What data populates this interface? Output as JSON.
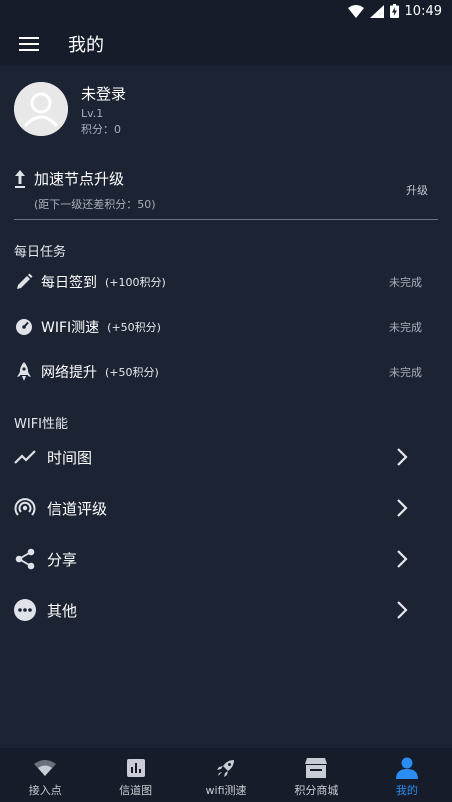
{
  "status_bar": {
    "time": "10:49"
  },
  "header": {
    "title": "我的"
  },
  "profile": {
    "name": "未登录",
    "level": "Lv.1",
    "points": "积分：0"
  },
  "upgrade": {
    "title": "加速节点升级",
    "subtitle": "(距下一级还差积分：50)",
    "button_label": "升级"
  },
  "daily_tasks": {
    "title": "每日任务",
    "items": [
      {
        "icon": "pencil-icon",
        "name": "每日签到",
        "bonus": "(+100积分)",
        "status": "未完成"
      },
      {
        "icon": "speedometer-icon",
        "name": "WIFI测速",
        "bonus": "(+50积分)",
        "status": "未完成"
      },
      {
        "icon": "rocket-icon",
        "name": "网络提升",
        "bonus": "(+50积分)",
        "status": "未完成"
      }
    ]
  },
  "wifi_performance": {
    "title": "WIFI性能",
    "items": [
      {
        "icon": "trending-chart-icon",
        "label": "时间图"
      },
      {
        "icon": "signal-rings-icon",
        "label": "信道评级"
      },
      {
        "icon": "share-icon",
        "label": "分享"
      },
      {
        "icon": "more-dots-icon",
        "label": "其他"
      }
    ]
  },
  "bottom_nav": {
    "items": [
      {
        "icon": "wifi-icon",
        "label": "接入点"
      },
      {
        "icon": "bar-chart-icon",
        "label": "信道图"
      },
      {
        "icon": "rocket-icon",
        "label": "wifi测速"
      },
      {
        "icon": "store-icon",
        "label": "积分商城"
      },
      {
        "icon": "person-icon",
        "label": "我的"
      }
    ],
    "active_index": 4,
    "active_color": "#2a8df2"
  }
}
